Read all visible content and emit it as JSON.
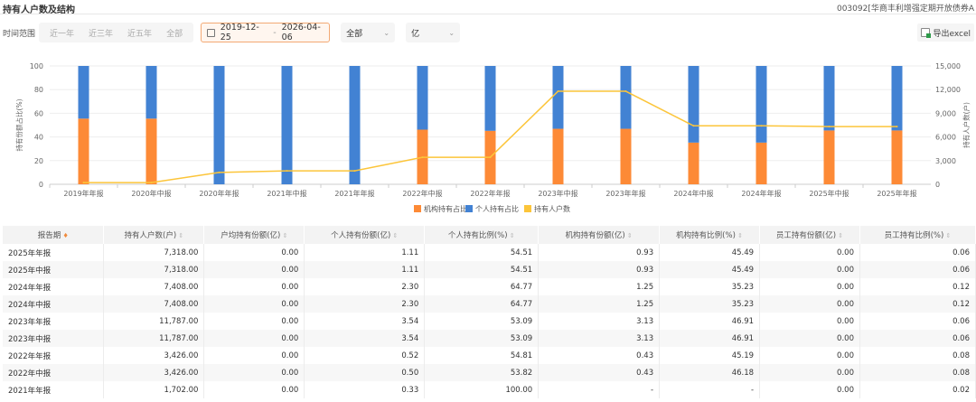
{
  "header": {
    "title": "持有人户数及结构",
    "fund": "003092[华商丰利增强定期开放债券A"
  },
  "filters": {
    "label": "时间范围",
    "ranges": [
      "近一年",
      "近三年",
      "近五年",
      "全部"
    ],
    "date_start": "2019-12-25",
    "date_sep": "-",
    "date_end": "2026-04-06",
    "type_select": "全部",
    "unit_select": "亿",
    "export": "导出excel"
  },
  "colors": {
    "institution": "#fd8a36",
    "individual": "#4282d3",
    "holders": "#fcc53a"
  },
  "chart_data": {
    "type": "bar+line",
    "categories": [
      "2019年年报",
      "2020年中报",
      "2020年年报",
      "2021年中报",
      "2021年年报",
      "2022年中报",
      "2022年年报",
      "2023年中报",
      "2023年年报",
      "2024年中报",
      "2024年年报",
      "2025年中报",
      "2025年年报"
    ],
    "series": [
      {
        "name": "机构持有占比",
        "type": "bar",
        "axis": "left",
        "values": [
          55.5,
          55.5,
          0,
          0,
          0,
          46.18,
          45.19,
          46.91,
          46.91,
          35.23,
          35.23,
          45.49,
          45.49
        ]
      },
      {
        "name": "个人持有占比",
        "type": "bar",
        "axis": "left",
        "values": [
          44.5,
          44.5,
          100,
          100,
          100,
          53.82,
          54.81,
          53.09,
          53.09,
          64.77,
          64.77,
          54.51,
          54.51
        ]
      },
      {
        "name": "持有人户数",
        "type": "line",
        "axis": "right",
        "values": [
          220,
          220,
          1500,
          1702,
          1702,
          3426,
          3426,
          11787,
          11787,
          7408,
          7408,
          7318,
          7318
        ]
      }
    ],
    "ylabel_left": "持有份额占比(%)",
    "ylabel_right": "持有人户数(户)",
    "ylim_left": [
      0,
      100
    ],
    "ylim_right": [
      0,
      15000
    ],
    "yticks_left": [
      "0",
      "20",
      "40",
      "60",
      "80",
      "100"
    ],
    "yticks_right": [
      "0",
      "3,000",
      "6,000",
      "9,000",
      "12,000",
      "15,000"
    ],
    "legend": "bottom"
  },
  "table": {
    "headers": [
      "报告期",
      "持有人户数(户)",
      "户均持有份额(亿)",
      "个人持有份额(亿)",
      "个人持有比例(%)",
      "机构持有份额(亿)",
      "机构持有比例(%)",
      "员工持有份额(亿)",
      "员工持有比例(%)"
    ],
    "rows": [
      [
        "2025年年报",
        "7,318.00",
        "0.00",
        "1.11",
        "54.51",
        "0.93",
        "45.49",
        "0.00",
        "0.06"
      ],
      [
        "2025年中报",
        "7,318.00",
        "0.00",
        "1.11",
        "54.51",
        "0.93",
        "45.49",
        "0.00",
        "0.06"
      ],
      [
        "2024年年报",
        "7,408.00",
        "0.00",
        "2.30",
        "64.77",
        "1.25",
        "35.23",
        "0.00",
        "0.12"
      ],
      [
        "2024年中报",
        "7,408.00",
        "0.00",
        "2.30",
        "64.77",
        "1.25",
        "35.23",
        "0.00",
        "0.12"
      ],
      [
        "2023年年报",
        "11,787.00",
        "0.00",
        "3.54",
        "53.09",
        "3.13",
        "46.91",
        "0.00",
        "0.06"
      ],
      [
        "2023年中报",
        "11,787.00",
        "0.00",
        "3.54",
        "53.09",
        "3.13",
        "46.91",
        "0.00",
        "0.06"
      ],
      [
        "2022年年报",
        "3,426.00",
        "0.00",
        "0.52",
        "54.81",
        "0.43",
        "45.19",
        "0.00",
        "0.08"
      ],
      [
        "2022年中报",
        "3,426.00",
        "0.00",
        "0.50",
        "53.82",
        "0.43",
        "46.18",
        "0.00",
        "0.08"
      ],
      [
        "2021年年报",
        "1,702.00",
        "0.00",
        "0.33",
        "100.00",
        "-",
        "-",
        "0.00",
        "0.02"
      ]
    ]
  }
}
